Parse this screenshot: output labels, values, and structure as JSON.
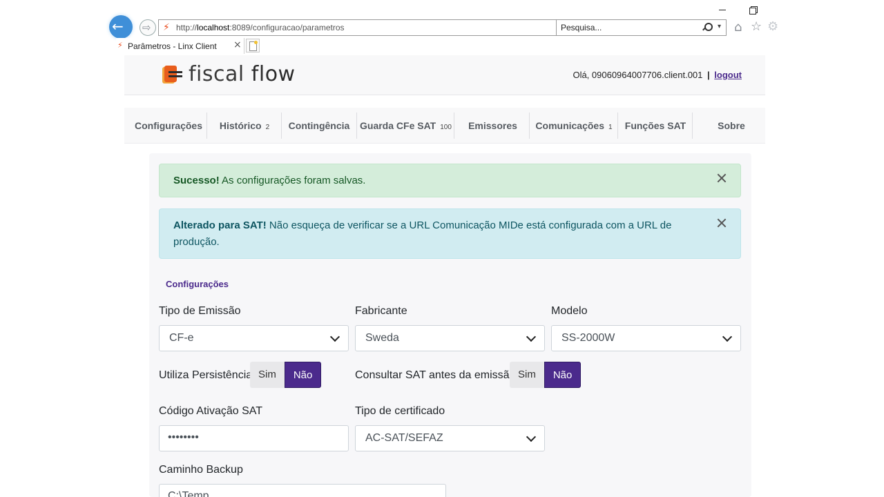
{
  "browser": {
    "url_prefix": "http://",
    "url_host": "localhost",
    "url_rest": ":8089/configuracao/parametros",
    "search_placeholder": "Pesquisa...",
    "tab_title": "Parâmetros - Linx Client",
    "tab_close": "×"
  },
  "header": {
    "logo_part1": "fiscal",
    "logo_part2": "flow",
    "greeting": "Olá, 09060964007706.client.001",
    "separator": "|",
    "logout": "logout"
  },
  "nav": {
    "items": [
      {
        "label": "Configurações",
        "count": ""
      },
      {
        "label": "Histórico",
        "count": "2"
      },
      {
        "label": "Contingência",
        "count": ""
      },
      {
        "label": "Guarda CFe SAT",
        "count": "100"
      },
      {
        "label": "Emissores",
        "count": ""
      },
      {
        "label": "Comunicações",
        "count": "1"
      },
      {
        "label": "Funções SAT",
        "count": ""
      },
      {
        "label": "Sobre",
        "count": ""
      }
    ]
  },
  "alerts": {
    "success": {
      "strong": "Sucesso!",
      "text": " As configurações foram salvas."
    },
    "info": {
      "strong": "Alterado para SAT!",
      "text": " Não esqueça de verificar se a URL Comunicação MIDe está configurada com a URL de produção."
    }
  },
  "form": {
    "section_title": "Configurações",
    "tipo_emissao": {
      "label": "Tipo de Emissão",
      "value": "CF-e"
    },
    "fabricante": {
      "label": "Fabricante",
      "value": "Sweda"
    },
    "modelo": {
      "label": "Modelo",
      "value": "SS-2000W"
    },
    "persistencia": {
      "label": "Utiliza Persistência",
      "yes": "Sim",
      "no": "Não",
      "selected": "Não"
    },
    "consultar_sat": {
      "label": "Consultar SAT antes da emissão",
      "yes": "Sim",
      "no": "Não",
      "selected": "Não"
    },
    "codigo_ativacao": {
      "label": "Código Ativação SAT",
      "value": "••••••••"
    },
    "tipo_certificado": {
      "label": "Tipo de certificado",
      "value": "AC-SAT/SEFAZ"
    },
    "caminho_backup": {
      "label": "Caminho Backup",
      "value": "C:\\Temp"
    }
  },
  "colors": {
    "brand_purple": "#4b2a8c",
    "success_bg": "#d4edda",
    "info_bg": "#d1ecf1",
    "logo_orange": "#e85d1c"
  }
}
